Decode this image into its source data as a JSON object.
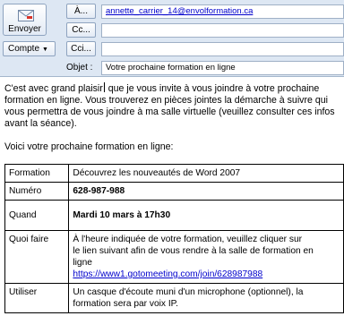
{
  "compose": {
    "send_label": "Envoyer",
    "account_label": "Compte",
    "to_button": "À...",
    "cc_button": "Cc...",
    "bcc_button": "Cci...",
    "to_value": "annette_carrier_14@envolformation.ca",
    "cc_value": "",
    "bcc_value": "",
    "subject_label": "Objet :",
    "subject_value": "Votre prochaine formation en ligne"
  },
  "body": {
    "para1_before_cursor": "C'est avec grand plaisir",
    "para1_after_cursor": " que je vous invite à vous joindre à votre prochaine",
    "para1_line2": "formation en ligne. Vous trouverez en pièces jointes la démarche à suivre qui",
    "para1_line3": "vous permettra de vous joindre à ma salle virtuelle (veuillez consulter ces infos",
    "para1_line4": "avant la séance).",
    "para2": "Voici votre prochaine formation en ligne:",
    "table": {
      "row1": {
        "label": "Formation",
        "value": "Découvrez les nouveautés de Word 2007"
      },
      "row2": {
        "label": "Numéro",
        "value": "628-987-988"
      },
      "row3": {
        "label": "Quand",
        "value": "Mardi 10 mars à 17h30"
      },
      "row4": {
        "label": "Quoi faire",
        "value_line1": "À l'heure indiquée de votre formation, veuillez cliquer sur",
        "value_line2": "le lien suivant afin de vous rendre à la salle de formation en",
        "value_line3": "ligne",
        "link": "https://www1.gotomeeting.com/join/628987988"
      },
      "row5": {
        "label": "Utiliser",
        "value_line1": "Un casque d'écoute muni d'un microphone (optionnel), la",
        "value_line2": "formation sera par voix IP."
      }
    }
  }
}
